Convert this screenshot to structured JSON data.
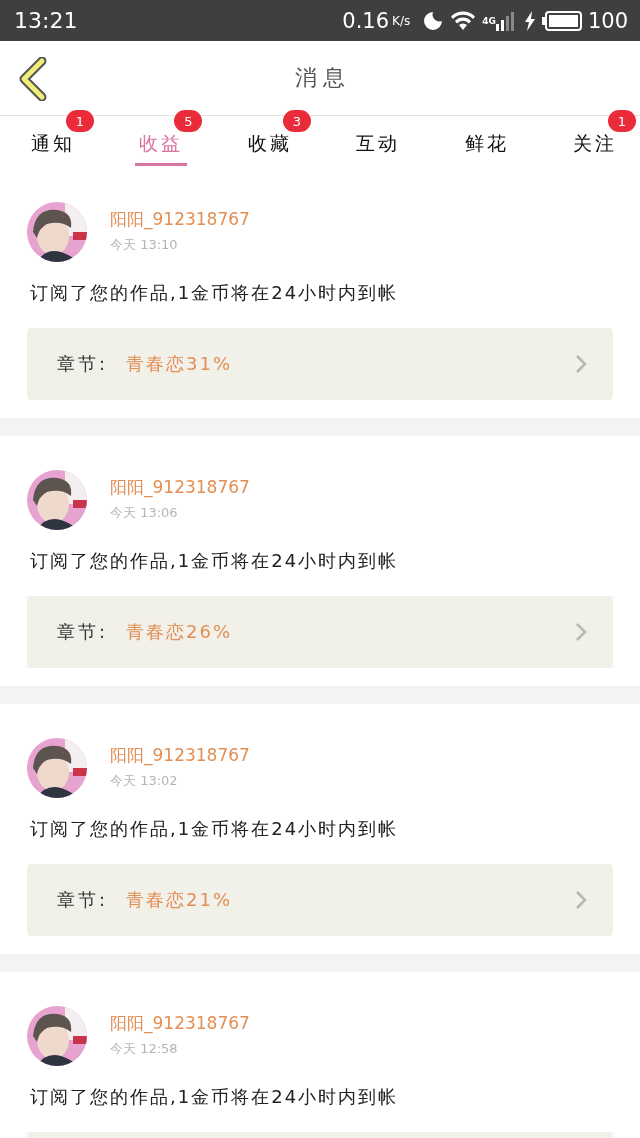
{
  "status_bar": {
    "time": "13:21",
    "speed": "0.16",
    "speed_unit": "K/s",
    "network": "4G",
    "battery": "100"
  },
  "header": {
    "title": "消 息"
  },
  "tabs": [
    {
      "label": "通知",
      "badge": "1",
      "selected": false
    },
    {
      "label": "收益",
      "badge": "5",
      "selected": true
    },
    {
      "label": "收藏",
      "badge": "3",
      "selected": false
    },
    {
      "label": "互动",
      "selected": false
    },
    {
      "label": "鲜花",
      "selected": false
    },
    {
      "label": "关注",
      "badge": "1",
      "selected": false
    }
  ],
  "messages": [
    {
      "name": "阳阳_912318767",
      "time": "今天 13:10",
      "text": "订阅了您的作品,1金币将在24小时内到帐",
      "chapter_label": "章节:",
      "chapter_title": "青春恋31%"
    },
    {
      "name": "阳阳_912318767",
      "time": "今天 13:06",
      "text": "订阅了您的作品,1金币将在24小时内到帐",
      "chapter_label": "章节:",
      "chapter_title": "青春恋26%"
    },
    {
      "name": "阳阳_912318767",
      "time": "今天 13:02",
      "text": "订阅了您的作品,1金币将在24小时内到帐",
      "chapter_label": "章节:",
      "chapter_title": "青春恋21%"
    },
    {
      "name": "阳阳_912318767",
      "time": "今天 12:58",
      "text": "订阅了您的作品,1金币将在24小时内到帐"
    }
  ]
}
